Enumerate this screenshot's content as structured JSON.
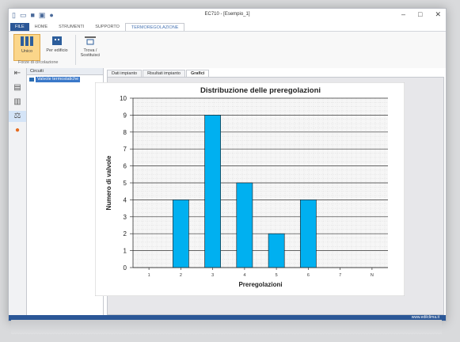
{
  "window": {
    "title": "EC710 - [Esempio_1]"
  },
  "quick_access": {
    "icons": [
      "new-icon",
      "open-icon",
      "save-icon",
      "print-icon",
      "help-icon"
    ]
  },
  "menu": {
    "items": [
      "FILE",
      "HOME",
      "STRUMENTI",
      "SUPPORTO",
      "TERMOREGOLAZIONE"
    ],
    "active": "TERMOREGOLAZIONE"
  },
  "ribbon": {
    "buttons": [
      {
        "label": "Unico"
      },
      {
        "label": "Per edificio"
      },
      {
        "label": "Trova /\nSostituisci"
      }
    ],
    "group_label": "Forze di circolazione"
  },
  "tree": {
    "header": "Circuiti",
    "items": [
      {
        "label": "Valvole termostatiche"
      }
    ]
  },
  "tabs": {
    "items": [
      "Dati impianto",
      "Risultati impianto",
      "Grafici"
    ],
    "active_index": 2
  },
  "status": {
    "right_text": "www.edilclima.it"
  },
  "colors": {
    "accent": "#2b5797",
    "bar": "#00b0f0",
    "ribbon_selected": "#fbd68a"
  },
  "chart_data": {
    "type": "bar",
    "title": "Distribuzione delle preregolazioni",
    "xlabel": "Preregolazioni",
    "ylabel": "Numero di valvole",
    "categories": [
      "1",
      "2",
      "3",
      "4",
      "5",
      "6",
      "7",
      "N"
    ],
    "values": [
      0,
      4,
      9,
      5,
      2,
      4,
      0,
      0
    ],
    "ylim": [
      0,
      10
    ],
    "yticks": [
      0,
      1,
      2,
      3,
      4,
      5,
      6,
      7,
      8,
      9,
      10
    ],
    "grid": true
  }
}
